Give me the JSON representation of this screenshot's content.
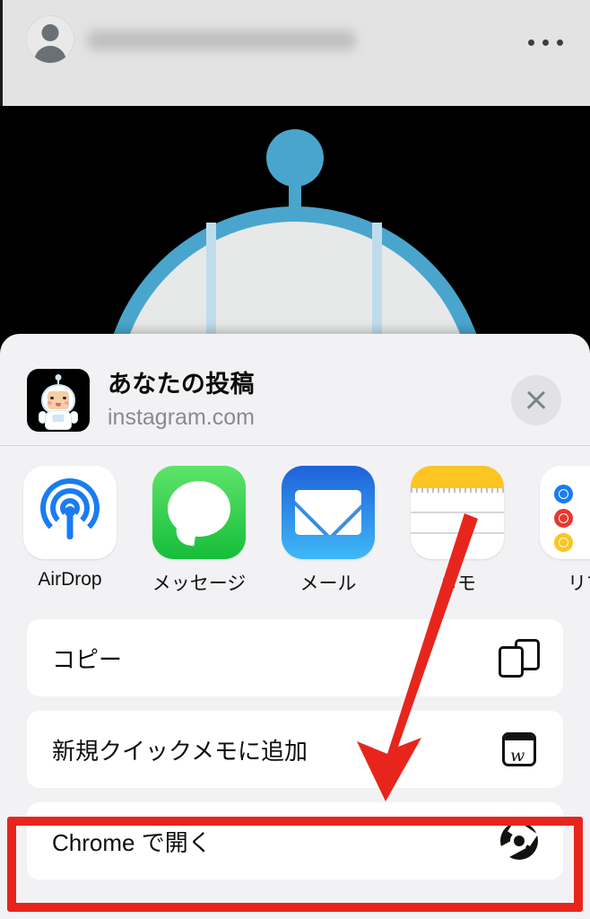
{
  "post_header": {
    "avatar_name": "user-avatar",
    "username_redacted": "",
    "more_menu_label": "•••"
  },
  "photo": {
    "alt_description": "astronaut character illustration"
  },
  "share_sheet": {
    "title": "あなたの投稿",
    "subtitle": "instagram.com",
    "close_label": "×",
    "apps": [
      {
        "label": "AirDrop",
        "icon": "airdrop-icon"
      },
      {
        "label": "メッセージ",
        "icon": "messages-icon"
      },
      {
        "label": "メール",
        "icon": "mail-icon"
      },
      {
        "label": "メモ",
        "icon": "notes-icon"
      },
      {
        "label": "リマ",
        "icon": "reminders-icon"
      }
    ],
    "actions": [
      {
        "label": "コピー",
        "icon": "copy-icon"
      },
      {
        "label": "新規クイックメモに追加",
        "icon": "quick-note-icon"
      },
      {
        "label": "Chrome で開く",
        "icon": "chrome-icon"
      }
    ]
  },
  "annotation": {
    "highlight_color": "#e8251c",
    "arrow_color": "#e8251c",
    "target_label": "Chrome で開く"
  },
  "colors": {
    "sheet_background": "#f2f2f5",
    "row_background": "#ffffff",
    "subtitle_gray": "#8a8a8f",
    "accent_red": "#e8251c",
    "airdrop_blue": "#1a7cf0",
    "messages_green": "#16bd3a",
    "mail_blue": "#3fb8f6",
    "notes_yellow": "#fdc521"
  }
}
